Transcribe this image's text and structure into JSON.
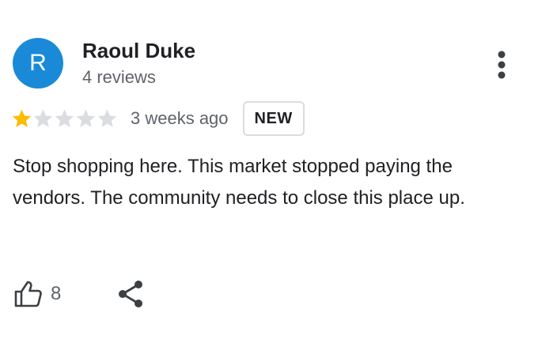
{
  "review": {
    "author": {
      "initial": "R",
      "name": "Raoul Duke",
      "review_count": "4 reviews",
      "avatar_color": "#1a8ad8"
    },
    "rating": 1,
    "max_rating": 5,
    "star_filled_color": "#fbbc04",
    "star_empty_color": "#dadce0",
    "date": "3 weeks ago",
    "badge": "NEW",
    "text": "Stop shopping here. This market stopped paying the vendors. The community needs to close this place up.",
    "likes": "8",
    "icons": {
      "more": "more-vert-icon",
      "like": "thumb-up-icon",
      "share": "share-icon"
    }
  }
}
